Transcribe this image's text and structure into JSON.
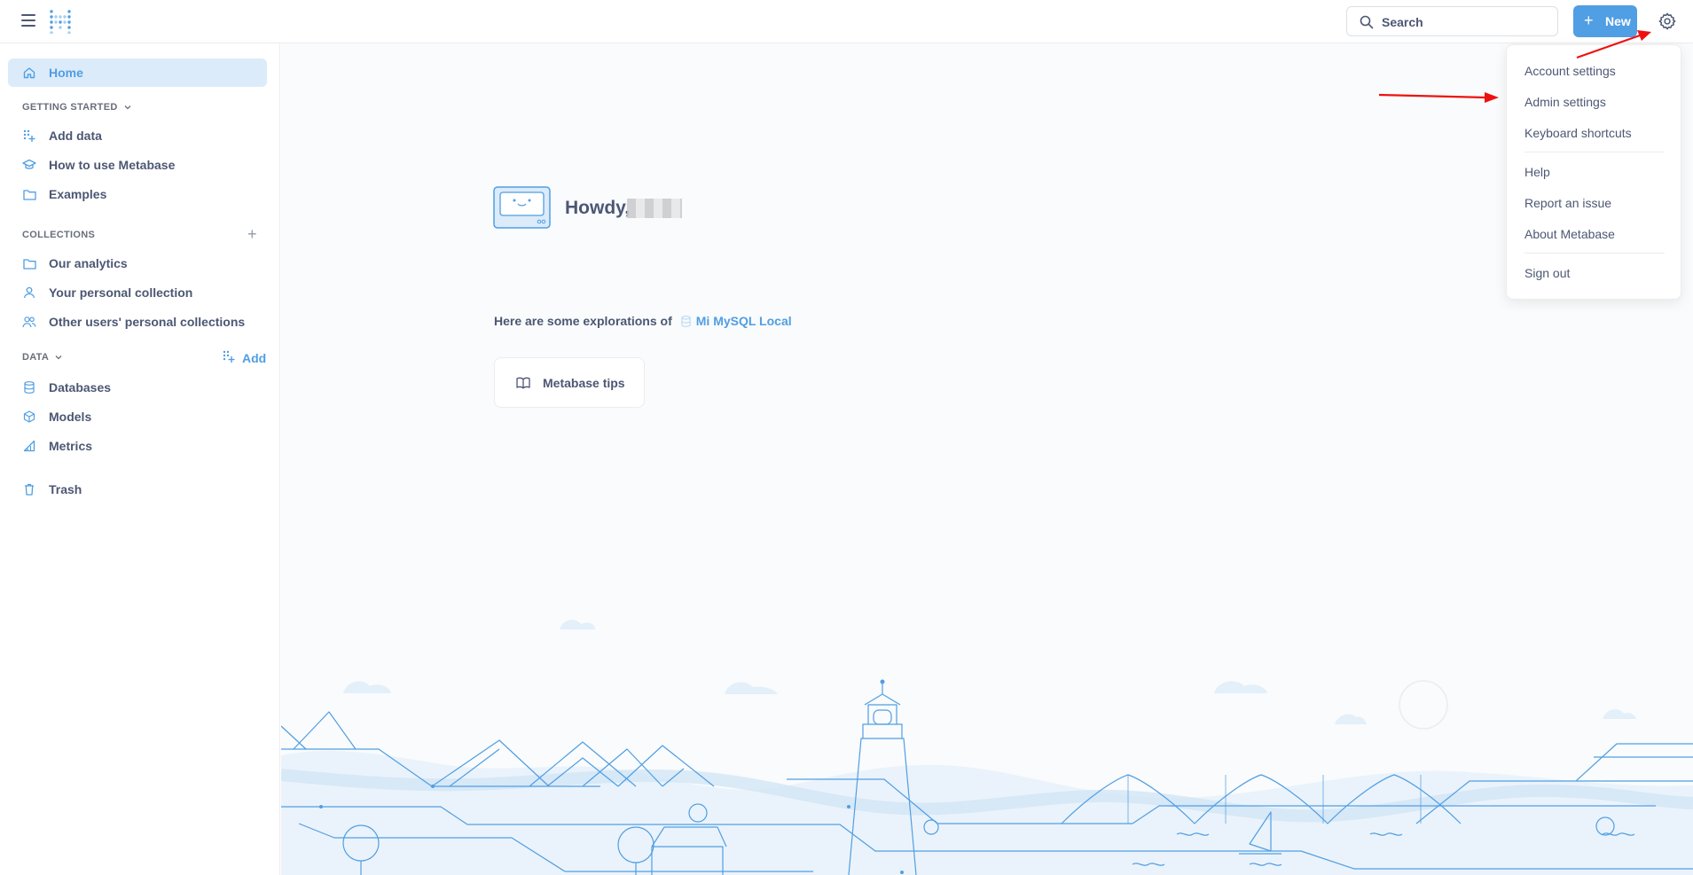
{
  "header": {
    "search_placeholder": "Search",
    "new_label": "New"
  },
  "sidebar": {
    "home": "Home",
    "getting_started": "GETTING STARTED",
    "getting_started_items": [
      "Add data",
      "How to use Metabase",
      "Examples"
    ],
    "collections": "COLLECTIONS",
    "collection_items": [
      "Our analytics",
      "Your personal collection",
      "Other users' personal collections"
    ],
    "data": "DATA",
    "data_add": "Add",
    "data_items": [
      "Databases",
      "Models",
      "Metrics"
    ],
    "trash": "Trash"
  },
  "main": {
    "greeting": "Howdy,",
    "explore_prefix": "Here are some explorations of",
    "database_name": "Mi MySQL Local",
    "tips_label": "Metabase tips"
  },
  "settings_menu": {
    "items": [
      "Account settings",
      "Admin settings",
      "Keyboard shortcuts",
      "Help",
      "Report an issue",
      "About Metabase",
      "Sign out"
    ]
  },
  "colors": {
    "brand": "#509ee3",
    "text": "#4c5773",
    "active_bg": "#dcebf9",
    "annotation_arrow": "#ee1111"
  }
}
